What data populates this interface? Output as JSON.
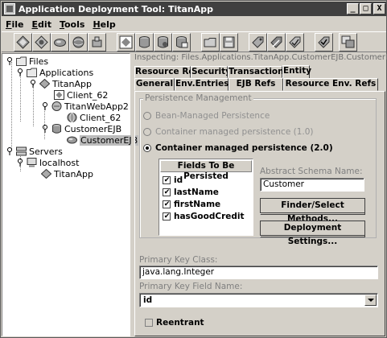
{
  "window": {
    "title": "Application Deployment Tool: TitanApp",
    "minimize": "_",
    "maximize": "□",
    "close": "X"
  },
  "menu": {
    "file": {
      "key": "F",
      "rest": "ile"
    },
    "edit": {
      "key": "E",
      "rest": "dit"
    },
    "tools": {
      "key": "T",
      "rest": "ools"
    },
    "help": {
      "key": "H",
      "rest": "elp"
    }
  },
  "tree": {
    "files": "Files",
    "applications": "Applications",
    "titanapp": "TitanApp",
    "client62a": "Client_62",
    "titanwebapp2": "TitanWebApp2",
    "client62b": "Client_62",
    "customerejb": "CustomerEJB",
    "customerejb_bean": "CustomerEJB",
    "servers": "Servers",
    "localhost": "localhost",
    "server_titanapp": "TitanApp"
  },
  "inspector": {
    "path": "Inspecting: Files.Applications.TitanApp.CustomerEJB.CustomerEJB",
    "tabs_row1": [
      "Resource Refs",
      "Security",
      "Transactions",
      "Entity"
    ],
    "tabs_row2": [
      "General",
      "Env.Entries",
      "EJB Refs",
      "Resource Env. Refs"
    ],
    "active_tab": "Entity"
  },
  "entity": {
    "persistence_group": "Persistence Management",
    "radio_bean": "Bean-Managed Persistence",
    "radio_cmp1": "Container managed persistence (1.0)",
    "radio_cmp2": "Container managed persistence (2.0)",
    "fields_header": "Fields To Be Persisted",
    "fields": [
      {
        "name": "id",
        "checked": true
      },
      {
        "name": "lastName",
        "checked": true
      },
      {
        "name": "firstName",
        "checked": true
      },
      {
        "name": "hasGoodCredit",
        "checked": true
      }
    ],
    "abstract_schema_label": "Abstract Schema Name:",
    "abstract_schema_value": "Customer",
    "finder_button": "Finder/Select Methods...",
    "deploy_button": "Deployment Settings...",
    "pk_class_label": "Primary Key Class:",
    "pk_class_value": "java.lang.Integer",
    "pk_field_label": "Primary Key Field Name:",
    "pk_field_value": "id",
    "reentrant_label": "Reentrant",
    "reentrant_checked": false
  }
}
